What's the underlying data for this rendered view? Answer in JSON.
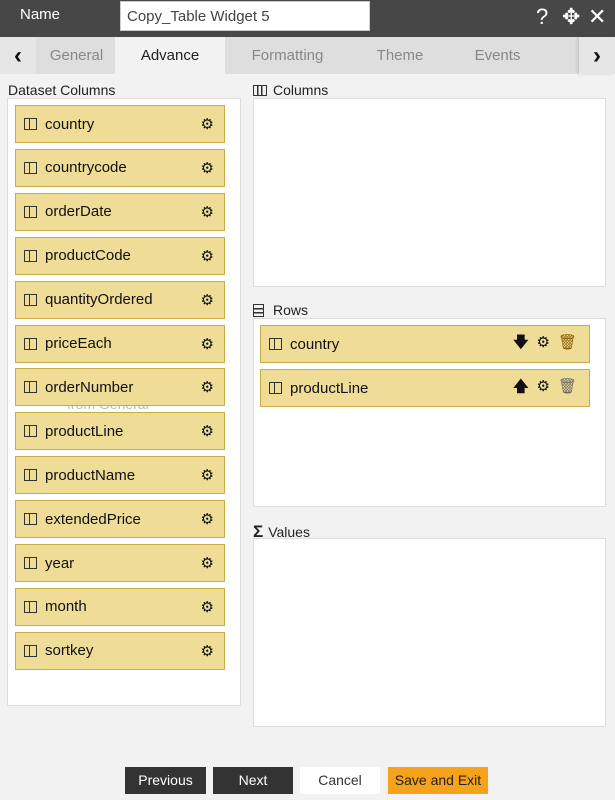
{
  "header": {
    "name_label": "Name",
    "name_value": "Copy_Table Widget 5",
    "icons": [
      "help-icon",
      "move-icon",
      "close-icon"
    ]
  },
  "tabs": [
    "General",
    "Advance",
    "Formatting",
    "Theme",
    "Events"
  ],
  "active_tab": "Advance",
  "dataset": {
    "title": "Dataset Columns",
    "items": [
      "country",
      "countrycode",
      "orderDate",
      "productCode",
      "quantityOrdered",
      "priceEach",
      "orderNumber",
      "productLine",
      "productName",
      "extendedPrice",
      "year",
      "month",
      "sortkey"
    ],
    "ghost_text": "from General"
  },
  "columns": {
    "title": "Columns"
  },
  "rows": {
    "title": "Rows",
    "items": [
      {
        "label": "country",
        "sort": "down"
      },
      {
        "label": "productLine",
        "sort": "up"
      }
    ]
  },
  "values": {
    "title": "Values"
  },
  "footer": {
    "previous": "Previous",
    "next": "Next",
    "cancel": "Cancel",
    "save": "Save and Exit"
  },
  "colors": {
    "header": "#474747",
    "item": "#efdc97",
    "item_border": "#c9ac48",
    "save": "#f7a21b",
    "dark_button": "#333333"
  }
}
